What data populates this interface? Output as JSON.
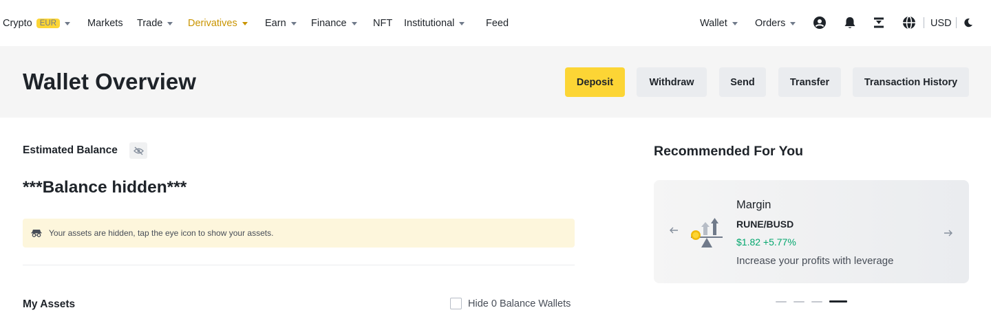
{
  "topnav": {
    "crypto": {
      "label": "Crypto",
      "badge": "EUR"
    },
    "markets": "Markets",
    "trade": "Trade",
    "derivatives": "Derivatives",
    "earn": "Earn",
    "finance": "Finance",
    "nft": "NFT",
    "institutional": "Institutional",
    "feed": "Feed",
    "wallet": "Wallet",
    "orders": "Orders",
    "currency": "USD",
    "icons": [
      "user-icon",
      "bell-icon",
      "download-icon",
      "globe-icon",
      "moon-icon"
    ]
  },
  "header": {
    "title": "Wallet Overview",
    "buttons": {
      "deposit": "Deposit",
      "withdraw": "Withdraw",
      "send": "Send",
      "transfer": "Transfer",
      "history": "Transaction History"
    }
  },
  "balance": {
    "label": "Estimated Balance",
    "hidden_text": "***Balance hidden***",
    "notice": "Your assets are hidden, tap the eye icon to show your assets."
  },
  "assets": {
    "title": "My Assets",
    "hide_zero_label": "Hide 0 Balance Wallets",
    "hide_zero_checked": false
  },
  "recommended": {
    "title": "Recommended For You",
    "card": {
      "name": "Margin",
      "pair": "RUNE/BUSD",
      "price": "$1.82 +5.77%",
      "description": "Increase your profits with leverage"
    },
    "slide_count": 4,
    "active_slide": 4
  },
  "colors": {
    "accent": "#fcd535",
    "active_nav": "#c99400",
    "positive": "#03a66d",
    "text": "#1e2329"
  }
}
